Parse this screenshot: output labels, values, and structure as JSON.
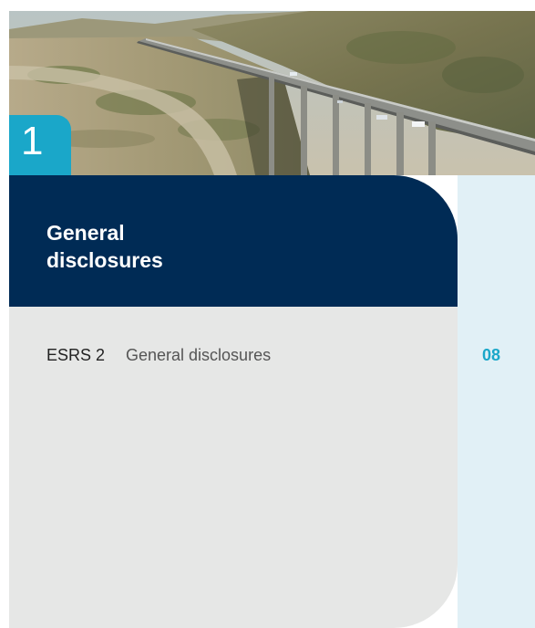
{
  "chapter": {
    "number": "1",
    "title_lines": [
      "General",
      "disclosures"
    ]
  },
  "toc": [
    {
      "code": "ESRS 2",
      "title": "General disclosures",
      "page": "08"
    }
  ],
  "colors": {
    "navy": "#002b55",
    "accent": "#1aa7c9",
    "panel_gray": "#e6e7e6",
    "column_blue": "#e1f0f6"
  },
  "hero_image": {
    "subject": "highway viaduct through a dry valley with hills"
  }
}
